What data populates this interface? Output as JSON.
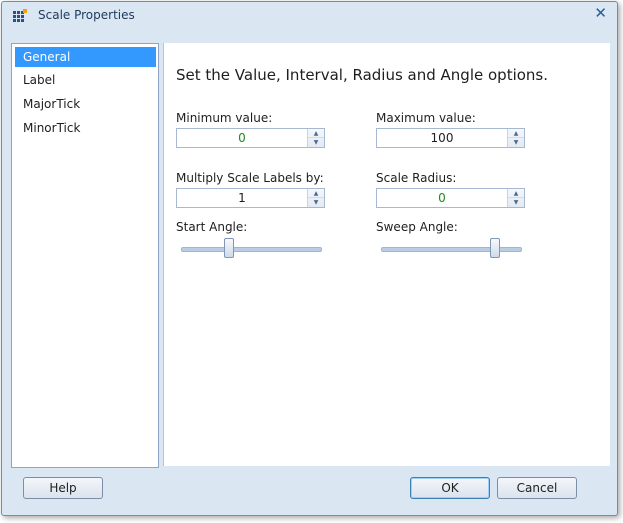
{
  "window": {
    "title": "Scale Properties",
    "close_glyph": "✕"
  },
  "sidebar": {
    "items": [
      {
        "label": "General",
        "selected": true
      },
      {
        "label": "Label",
        "selected": false
      },
      {
        "label": "MajorTick",
        "selected": false
      },
      {
        "label": "MinorTick",
        "selected": false
      }
    ]
  },
  "general": {
    "heading": "Set the Value, Interval, Radius and Angle options.",
    "minimum": {
      "label": "Minimum value:",
      "value": "0"
    },
    "maximum": {
      "label": "Maximum value:",
      "value": "100"
    },
    "multiply": {
      "label": "Multiply Scale Labels by:",
      "value": "1"
    },
    "radius": {
      "label": "Scale Radius:",
      "value": "0"
    },
    "start_angle": {
      "label": "Start Angle:",
      "level": 0.33
    },
    "sweep_angle": {
      "label": "Sweep Angle:",
      "level": 0.83
    }
  },
  "footer": {
    "help_label": "Help",
    "ok_label": "OK",
    "cancel_label": "Cancel"
  },
  "icons": {
    "app": "grid-app-icon",
    "spin_up": "▲",
    "spin_down": "▼"
  },
  "colors": {
    "selected_bg": "#3399ff",
    "value_green": "#1f8a1f",
    "window_bg": "#dbe6f3"
  }
}
